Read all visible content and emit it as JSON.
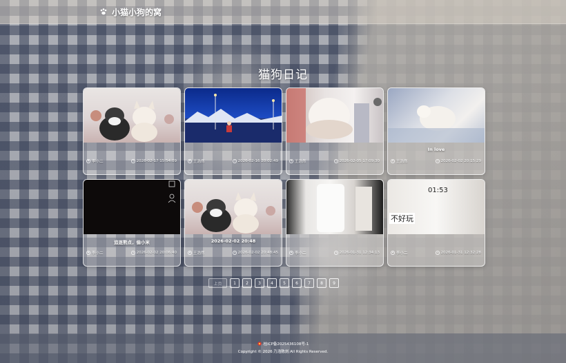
{
  "site": {
    "brand": "小猫小狗的窝",
    "brand_icon": "paw-icon"
  },
  "page_title": "猫狗日记",
  "cards": [
    {
      "caption": "",
      "author": "李小二",
      "date": "2026-02-17 15:54:09"
    },
    {
      "caption": "",
      "author": "王浩然",
      "date": "2026-02-16 20:02:49"
    },
    {
      "caption": "",
      "author": "王浩然",
      "date": "2026-02-05 17:09:30"
    },
    {
      "caption": "In love",
      "author": "王浩然",
      "date": "2026-02-02 20:15:29"
    },
    {
      "caption": "追逐熊点，偷小米",
      "author": "李小二",
      "date": "2026-02-02 20:06:40"
    },
    {
      "caption": "2026-02-02 20:48",
      "author": "王浩然",
      "date": "2026-02-02 20:48:45"
    },
    {
      "caption": "",
      "author": "李小二",
      "date": "2026-01-31 12:34:13"
    },
    {
      "caption": "",
      "author": "李小二",
      "date": "2026-01-31 12:32:28"
    }
  ],
  "thumb_text": {
    "card8_time": "01:53",
    "card8_label": "不好玩"
  },
  "pagination": {
    "prev": "上页",
    "pages": [
      "1",
      "2",
      "3",
      "4",
      "5",
      "6",
      "7",
      "8",
      "9"
    ]
  },
  "footer": {
    "icp": "桂ICP备2025436108号-1",
    "copyright": "Copyright © 2026 乃浩陈刘 All Rights Reserved."
  },
  "colors": {
    "card_border": "#ffffff",
    "topbar": "#d7d0c4",
    "footer": "#5f6473"
  }
}
